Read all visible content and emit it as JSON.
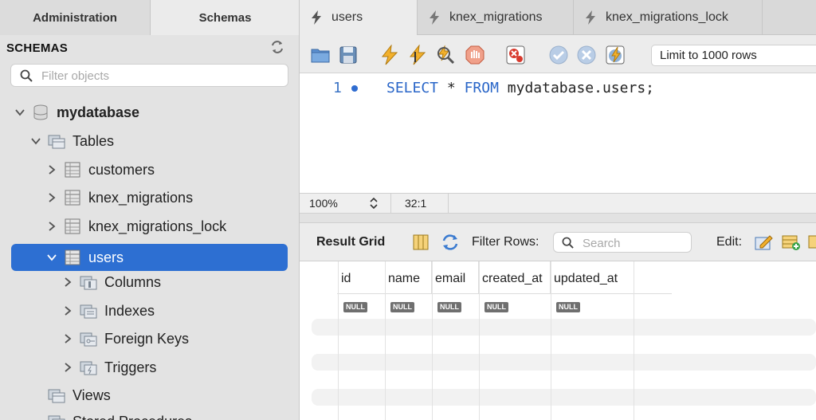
{
  "sidebar": {
    "tabs": [
      "Administration",
      "Schemas"
    ],
    "title": "SCHEMAS",
    "filter_placeholder": "Filter objects",
    "tree": {
      "database": "mydatabase",
      "tables_label": "Tables",
      "tables": [
        "customers",
        "knex_migrations",
        "knex_migrations_lock",
        "users"
      ],
      "selected_table": "users",
      "table_children": [
        "Columns",
        "Indexes",
        "Foreign Keys",
        "Triggers"
      ],
      "views_label": "Views",
      "stored_procedures_label": "Stored Procedures"
    }
  },
  "query_tabs": [
    "users",
    "knex_migrations",
    "knex_migrations_lock"
  ],
  "toolbar": {
    "icons": [
      "open-folder-icon",
      "save-icon",
      "execute-icon",
      "execute-statement-icon",
      "explain-icon",
      "stop-icon",
      "error-toggle-icon",
      "commit-icon",
      "rollback-icon",
      "autocommit-icon"
    ],
    "limit_select": "Limit to 1000 rows"
  },
  "editor": {
    "line_number": "1",
    "keyword_select": "SELECT",
    "star": "*",
    "keyword_from": "FROM",
    "table_ref": "mydatabase.users;"
  },
  "status": {
    "zoom": "100%",
    "cursor": "32:1"
  },
  "results": {
    "title": "Result Grid",
    "filter_label": "Filter Rows:",
    "search_placeholder": "Search",
    "edit_label": "Edit:",
    "columns": [
      "id",
      "name",
      "email",
      "created_at",
      "updated_at"
    ],
    "row_values": [
      "NULL",
      "NULL",
      "NULL",
      "NULL",
      "NULL"
    ]
  },
  "colors": {
    "selection": "#2d6fd2",
    "keyword": "#2a66c8"
  }
}
